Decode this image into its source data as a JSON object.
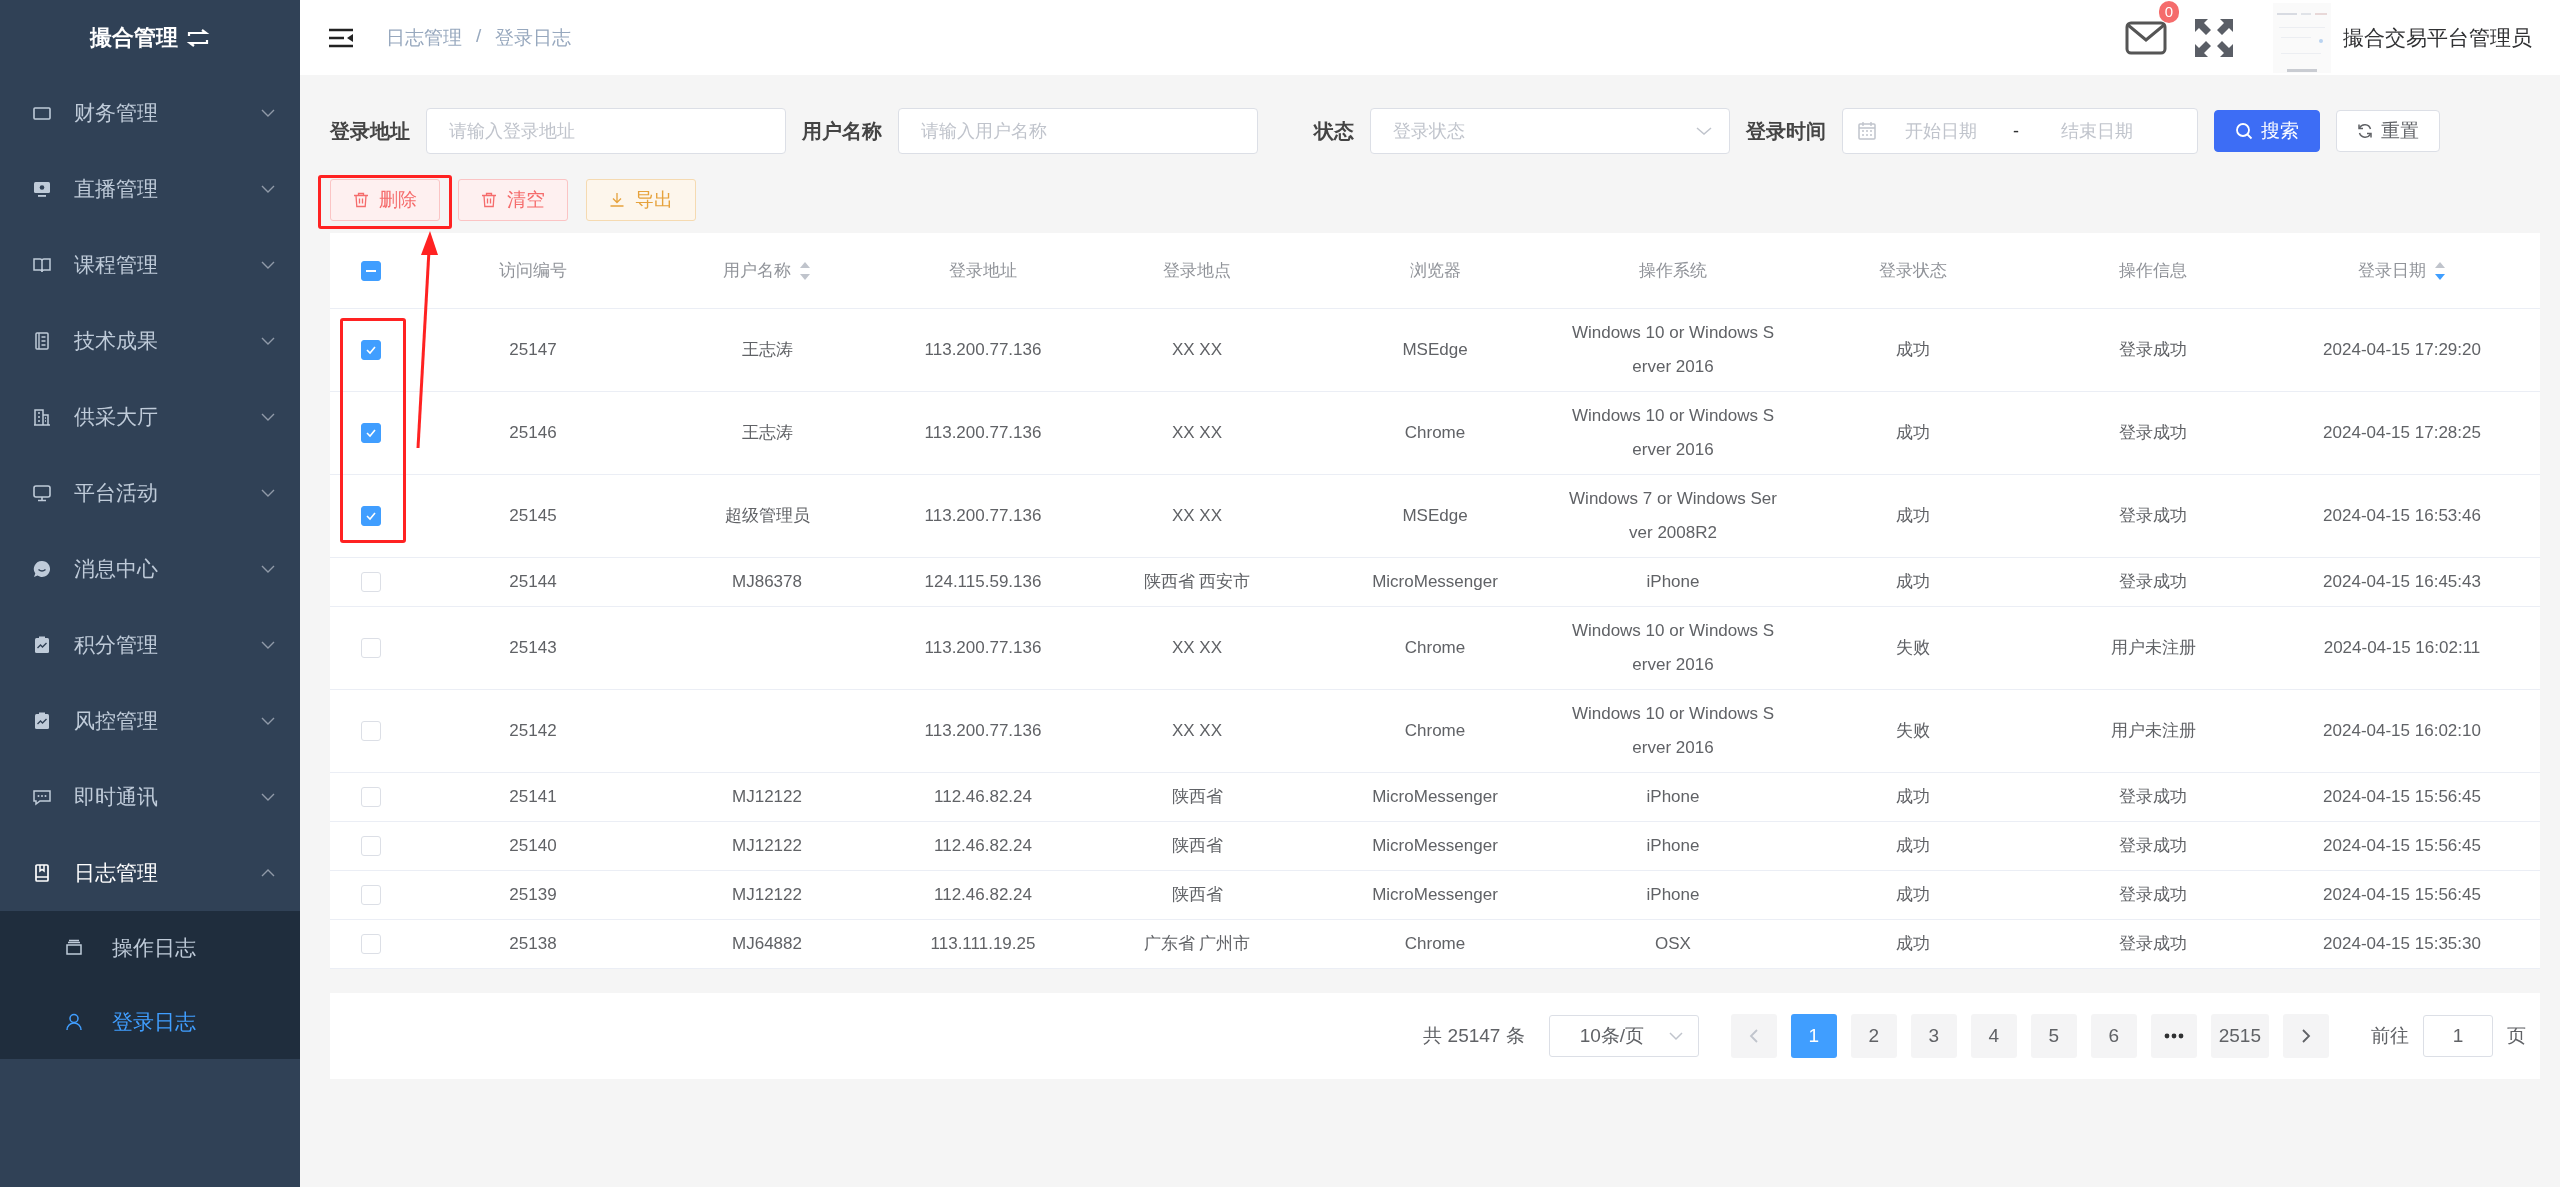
{
  "sidebar": {
    "title": "撮合管理",
    "items": [
      {
        "label": "财务管理",
        "expanded": false
      },
      {
        "label": "直播管理",
        "expanded": false
      },
      {
        "label": "课程管理",
        "expanded": false
      },
      {
        "label": "技术成果",
        "expanded": false
      },
      {
        "label": "供采大厅",
        "expanded": false
      },
      {
        "label": "平台活动",
        "expanded": false
      },
      {
        "label": "消息中心",
        "expanded": false
      },
      {
        "label": "积分管理",
        "expanded": false
      },
      {
        "label": "风控管理",
        "expanded": false
      },
      {
        "label": "即时通讯",
        "expanded": false
      },
      {
        "label": "日志管理",
        "expanded": true,
        "children": [
          {
            "label": "操作日志",
            "selected": false
          },
          {
            "label": "登录日志",
            "selected": true
          }
        ]
      }
    ]
  },
  "header": {
    "breadcrumb": [
      "日志管理",
      "登录日志"
    ],
    "breadcrumb_separator": "/",
    "mail_badge": "0",
    "user_name": "撮合交易平台管理员"
  },
  "filters": [
    {
      "kind": "input",
      "label": "登录地址",
      "placeholder": "请输入登录地址"
    },
    {
      "kind": "input",
      "label": "用户名称",
      "placeholder": "请输入用户名称"
    },
    {
      "kind": "select",
      "label": "状态",
      "placeholder": "登录状态"
    },
    {
      "kind": "daterange",
      "label": "登录时间",
      "start_placeholder": "开始日期",
      "separator": "-",
      "end_placeholder": "结束日期"
    }
  ],
  "filter_buttons": [
    {
      "kind": "primary",
      "label": "搜索"
    },
    {
      "kind": "default",
      "label": "重置"
    }
  ],
  "actions": [
    {
      "kind": "danger",
      "label": "删除"
    },
    {
      "kind": "danger",
      "label": "清空"
    },
    {
      "kind": "warning",
      "label": "导出"
    }
  ],
  "table": {
    "select_all_indeterminate": true,
    "columns": [
      {
        "label": "访问编号"
      },
      {
        "label": "用户名称",
        "sortable": true,
        "sorted_desc": false
      },
      {
        "label": "登录地址"
      },
      {
        "label": "登录地点"
      },
      {
        "label": "浏览器"
      },
      {
        "label": "操作系统"
      },
      {
        "label": "登录状态"
      },
      {
        "label": "操作信息"
      },
      {
        "label": "登录日期",
        "sortable": true,
        "sorted_desc": true
      }
    ],
    "rows": [
      {
        "selected": true,
        "cells": [
          "25147",
          "王志涛",
          "113.200.77.136",
          "XX XX",
          "MSEdge",
          "Windows 10 or Windows Server 2016",
          "成功",
          "登录成功",
          "2024-04-15 17:29:20"
        ]
      },
      {
        "selected": true,
        "cells": [
          "25146",
          "王志涛",
          "113.200.77.136",
          "XX XX",
          "Chrome",
          "Windows 10 or Windows Server 2016",
          "成功",
          "登录成功",
          "2024-04-15 17:28:25"
        ]
      },
      {
        "selected": true,
        "cells": [
          "25145",
          "超级管理员",
          "113.200.77.136",
          "XX XX",
          "MSEdge",
          "Windows 7 or Windows Server 2008R2",
          "成功",
          "登录成功",
          "2024-04-15 16:53:46"
        ]
      },
      {
        "selected": false,
        "cells": [
          "25144",
          "MJ86378",
          "124.115.59.136",
          "陕西省 西安市",
          "MicroMessenger",
          "iPhone",
          "成功",
          "登录成功",
          "2024-04-15 16:45:43"
        ]
      },
      {
        "selected": false,
        "cells": [
          "25143",
          null,
          "113.200.77.136",
          "XX XX",
          "Chrome",
          "Windows 10 or Windows Server 2016",
          "失败",
          "用户未注册",
          "2024-04-15 16:02:11"
        ]
      },
      {
        "selected": false,
        "cells": [
          "25142",
          null,
          "113.200.77.136",
          "XX XX",
          "Chrome",
          "Windows 10 or Windows Server 2016",
          "失败",
          "用户未注册",
          "2024-04-15 16:02:10"
        ]
      },
      {
        "selected": false,
        "cells": [
          "25141",
          "MJ12122",
          "112.46.82.24",
          "陕西省",
          "MicroMessenger",
          "iPhone",
          "成功",
          "登录成功",
          "2024-04-15 15:56:45"
        ]
      },
      {
        "selected": false,
        "cells": [
          "25140",
          "MJ12122",
          "112.46.82.24",
          "陕西省",
          "MicroMessenger",
          "iPhone",
          "成功",
          "登录成功",
          "2024-04-15 15:56:45"
        ]
      },
      {
        "selected": false,
        "cells": [
          "25139",
          "MJ12122",
          "112.46.82.24",
          "陕西省",
          "MicroMessenger",
          "iPhone",
          "成功",
          "登录成功",
          "2024-04-15 15:56:45"
        ]
      },
      {
        "selected": false,
        "cells": [
          "25138",
          "MJ64882",
          "113.111.19.25",
          "广东省 广州市",
          "Chrome",
          "OSX",
          "成功",
          "登录成功",
          "2024-04-15 15:35:30"
        ]
      }
    ]
  },
  "pagination": {
    "total": "共 25147 条",
    "page_size": "10条/页",
    "prev_disabled": true,
    "next_disabled": false,
    "pages": [
      {
        "kind": "page",
        "label": "1",
        "selected": true
      },
      {
        "kind": "page",
        "label": "2",
        "selected": false
      },
      {
        "kind": "page",
        "label": "3",
        "selected": false
      },
      {
        "kind": "page",
        "label": "4",
        "selected": false
      },
      {
        "kind": "page",
        "label": "5",
        "selected": false
      },
      {
        "kind": "page",
        "label": "6",
        "selected": false
      },
      {
        "kind": "more"
      },
      {
        "kind": "page",
        "label": "2515",
        "selected": false
      }
    ],
    "goto_label": "前往",
    "goto_value": "1",
    "goto_suffix": "页"
  }
}
